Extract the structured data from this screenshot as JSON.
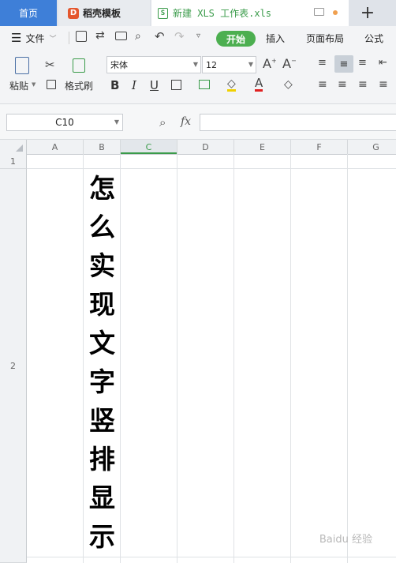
{
  "tabs": {
    "home": "首页",
    "docer": "稻壳模板",
    "file": "新建 XLS 工作表.xls"
  },
  "menu": {
    "file": "文件",
    "start": "开始",
    "insert": "插入",
    "page_layout": "页面布局",
    "formula": "公式"
  },
  "toolbar": {
    "paste": "粘贴",
    "format_painter": "格式刷",
    "font": "宋体",
    "font_size": "12"
  },
  "formula_bar": {
    "cell_ref": "C10",
    "fx": "fx",
    "value": ""
  },
  "columns": [
    "A",
    "B",
    "C",
    "D",
    "E",
    "F",
    "G"
  ],
  "rows": [
    "1",
    "2"
  ],
  "cell_b2_chars": [
    "怎",
    "么",
    "实",
    "现",
    "文",
    "字",
    "竖",
    "排",
    "显",
    "示"
  ],
  "watermark": "Baidu 经验",
  "colors": {
    "home_tab": "#3e7fd8",
    "start_button": "#4caf50",
    "file_tab_text": "#3a9b4a"
  }
}
